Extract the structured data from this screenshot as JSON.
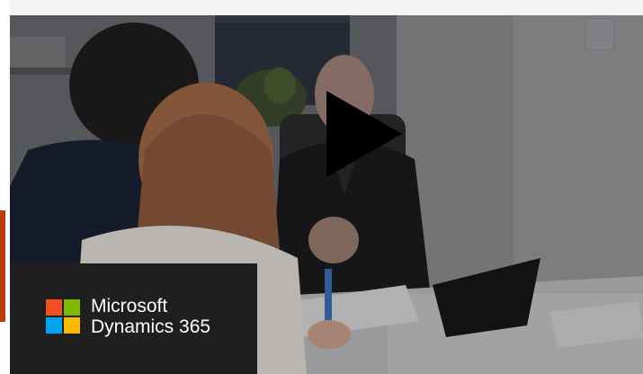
{
  "brand": {
    "line1": "Microsoft",
    "line2": "Dynamics 365",
    "logo_colors": [
      "#f25022",
      "#7fba00",
      "#00a4ef",
      "#ffb900"
    ]
  },
  "player": {
    "play_icon": "play-icon"
  },
  "colors": {
    "page_background": "#f3f3f3",
    "card_background": "#1f1f1f",
    "play_icon": "#000000",
    "left_accent": "#b5400d"
  }
}
